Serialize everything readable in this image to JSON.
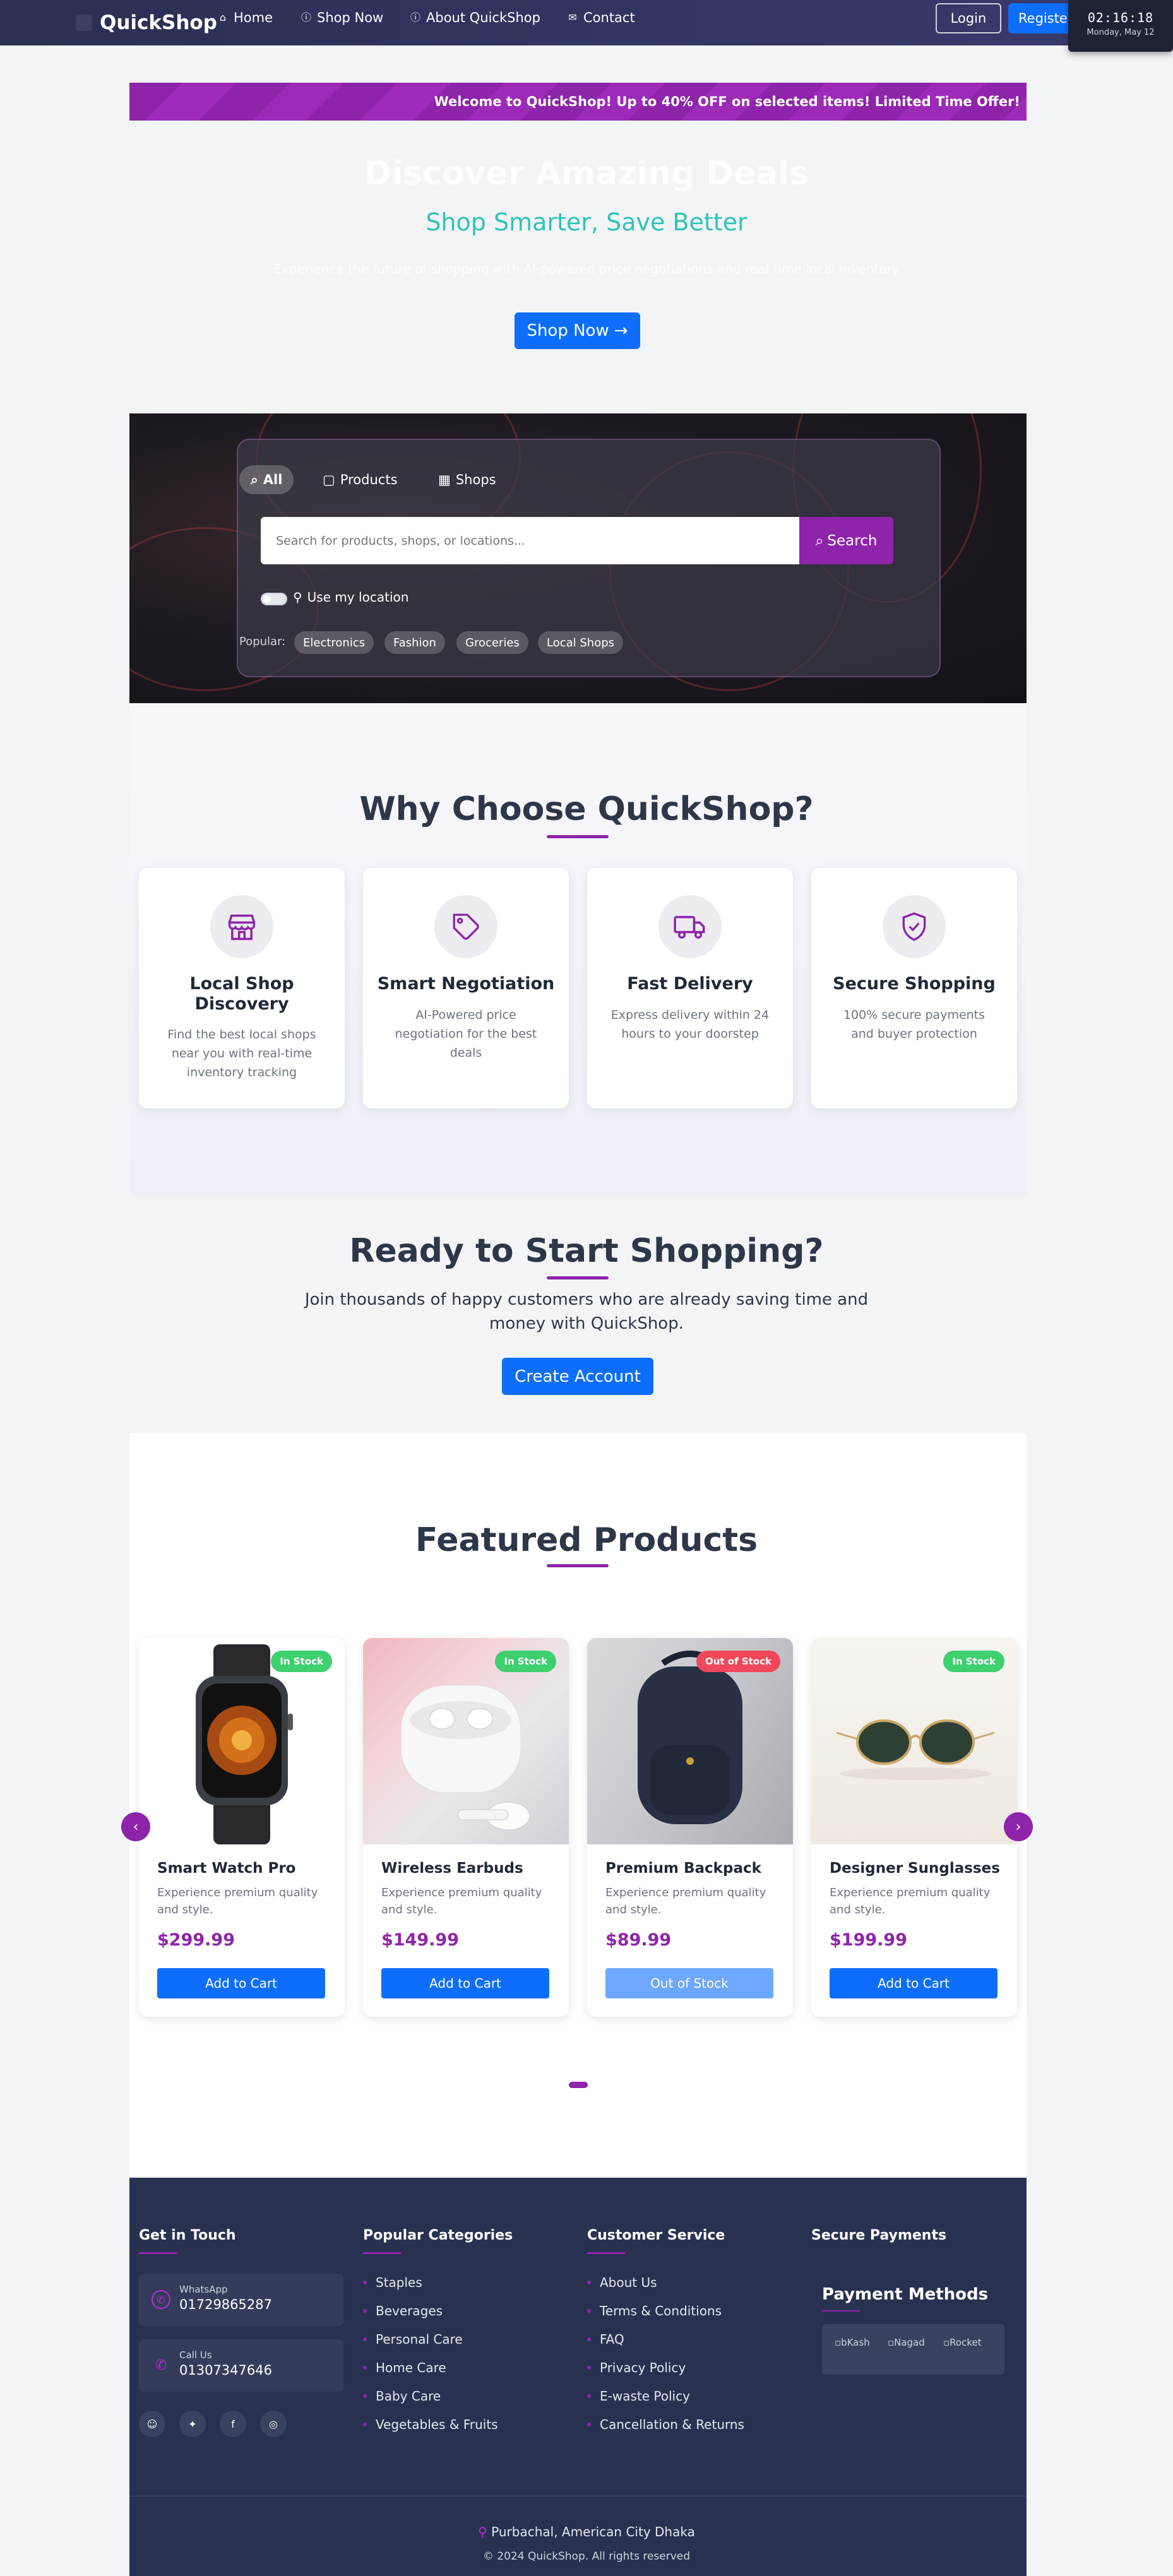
{
  "header": {
    "brand": "QuickShop",
    "nav": [
      {
        "label": "Home",
        "icon": "home-icon"
      },
      {
        "label": "Shop Now",
        "icon": "info-icon"
      },
      {
        "label": "About QuickShop",
        "icon": "info-icon"
      },
      {
        "label": "Contact",
        "icon": "mail-icon"
      }
    ],
    "login": "Login",
    "register": "Register",
    "clock_time": "02:16:18",
    "clock_date": "Monday, May 12"
  },
  "promo": "Welcome to QuickShop! Up to 40% OFF on selected items! Limited Time Offer!",
  "hero": {
    "title": "Discover Amazing Deals",
    "subtitle": "Shop Smarter, Save Better",
    "description": "Experience the future of shopping with AI-powered price negotiations and real-time local inventory",
    "button": "Shop Now"
  },
  "search": {
    "tabs": [
      {
        "label": "All",
        "icon": "search-icon",
        "active": true
      },
      {
        "label": "Products",
        "icon": "box-icon"
      },
      {
        "label": "Shops",
        "icon": "store-icon"
      }
    ],
    "placeholder": "Search for products, shops, or locations...",
    "button": "Search",
    "location_label": "Use my location",
    "popular_label": "Popular:",
    "popular": [
      "Electronics",
      "Fashion",
      "Groceries",
      "Local Shops"
    ]
  },
  "why": {
    "title": "Why Choose QuickShop?",
    "features": [
      {
        "title": "Local Shop Discovery",
        "desc": "Find the best local shops near you with real-time inventory tracking",
        "icon": "store-icon"
      },
      {
        "title": "Smart Negotiation",
        "desc": "AI-Powered price negotiation for the best deals",
        "icon": "tag-icon"
      },
      {
        "title": "Fast Delivery",
        "desc": "Express delivery within 24 hours to your doorstep",
        "icon": "truck-icon"
      },
      {
        "title": "Secure Shopping",
        "desc": "100% secure payments and buyer protection",
        "icon": "shield-check-icon"
      }
    ]
  },
  "ready": {
    "title": "Ready to Start Shopping?",
    "description": "Join thousands of happy customers who are already saving time and money with QuickShop.",
    "button": "Create Account"
  },
  "products": {
    "title": "Featured Products",
    "items": [
      {
        "name": "Smart Watch Pro",
        "desc": "Experience premium quality and style.",
        "price": "$299.99",
        "badge": "In Stock",
        "button": "Add to Cart",
        "in_stock": true
      },
      {
        "name": "Wireless Earbuds",
        "desc": "Experience premium quality and style.",
        "price": "$149.99",
        "badge": "In Stock",
        "button": "Add to Cart",
        "in_stock": true
      },
      {
        "name": "Premium Backpack",
        "desc": "Experience premium quality and style.",
        "price": "$89.99",
        "badge": "Out of Stock",
        "button": "Out of Stock",
        "in_stock": false
      },
      {
        "name": "Designer Sunglasses",
        "desc": "Experience premium quality and style.",
        "price": "$199.99",
        "badge": "In Stock",
        "button": "Add to Cart",
        "in_stock": true
      }
    ],
    "colors": {
      "in_stock": "#3ecf6e",
      "out_of_stock": "#f0485a"
    }
  },
  "footer": {
    "contact_title": "Get in Touch",
    "whatsapp_label": "WhatsApp",
    "whatsapp": "01729865287",
    "call_label": "Call Us",
    "call": "01307347646",
    "categories_title": "Popular Categories",
    "categories": [
      "Staples",
      "Beverages",
      "Personal Care",
      "Home Care",
      "Baby Care",
      "Vegetables & Fruits"
    ],
    "service_title": "Customer Service",
    "service": [
      "About Us",
      "Terms & Conditions",
      "FAQ",
      "Privacy Policy",
      "E-waste Policy",
      "Cancellation & Returns"
    ],
    "secure_title": "Secure Payments",
    "payment_title": "Payment Methods",
    "payments": [
      "bKash",
      "Nagad",
      "Rocket"
    ],
    "address": "Purbachal, American City Dhaka",
    "copyright": "© 2024 QuickShop. All rights reserved"
  }
}
